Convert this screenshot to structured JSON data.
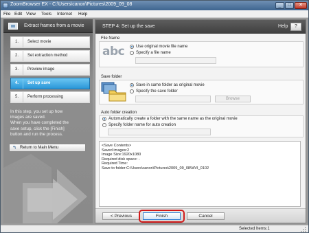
{
  "window": {
    "title": "ZoomBrowser EX  -  C:\\Users\\canon\\Pictures\\2009_09_08",
    "controls": {
      "minimize": "_",
      "maximize": "□",
      "close": "✕"
    }
  },
  "menu": [
    "File",
    "Edit",
    "View",
    "Tools",
    "Internet",
    "Help"
  ],
  "left_panel": {
    "title": "Extract frames from a movie",
    "steps": [
      {
        "num": "1.",
        "label": "Select movie",
        "active": false
      },
      {
        "num": "2.",
        "label": "Set extraction method",
        "active": false
      },
      {
        "num": "3.",
        "label": "Preview image",
        "active": false
      },
      {
        "num": "4.",
        "label": "Set up save",
        "active": true
      },
      {
        "num": "5.",
        "label": "Perform processing",
        "active": false
      }
    ],
    "help_lines": [
      "In this step, you set up how",
      "images are saved.",
      "When you have completed the",
      "save setup, click the [Finish]",
      "button and run the process."
    ],
    "return_button": "Return to Main Menu"
  },
  "right_panel": {
    "step_title": "STEP 4: Set up the save",
    "help_label": "Help",
    "help_button": "?",
    "file_name": {
      "title": "File Name",
      "icon_text": "abc",
      "option_original": "Use original movie file name",
      "option_specify": "Specify a file name",
      "selected": "original",
      "input_value": ""
    },
    "save_folder": {
      "title": "Save folder",
      "option_same": "Save in same folder as original movie",
      "option_specify": "Specify the save folder",
      "selected": "same",
      "input_value": "",
      "browse_label": "Browse"
    },
    "auto_folder": {
      "title": "Auto folder creation",
      "option_auto": "Automatically create a folder with the same name as the original movie",
      "option_specify": "Specify folder name for auto creation",
      "selected": "auto",
      "input_value": ""
    },
    "summary": [
      "<Save Contents>",
      "Saved images:2",
      "Image Size:1920x1080",
      "Required disk space:  -",
      "Required Time:",
      "Save to folder:C:\\Users\\canon\\Pictures\\2009_09_08\\MVI_0102"
    ],
    "buttons": {
      "previous": "< Previous",
      "finish": "Finish",
      "cancel": "Cancel"
    }
  },
  "status_bar": {
    "text": "Selected Items:1"
  },
  "colors": {
    "accent": "#2a96d8",
    "highlight_ring": "#d11a1a",
    "panel_dark": "#4a4a4a"
  }
}
